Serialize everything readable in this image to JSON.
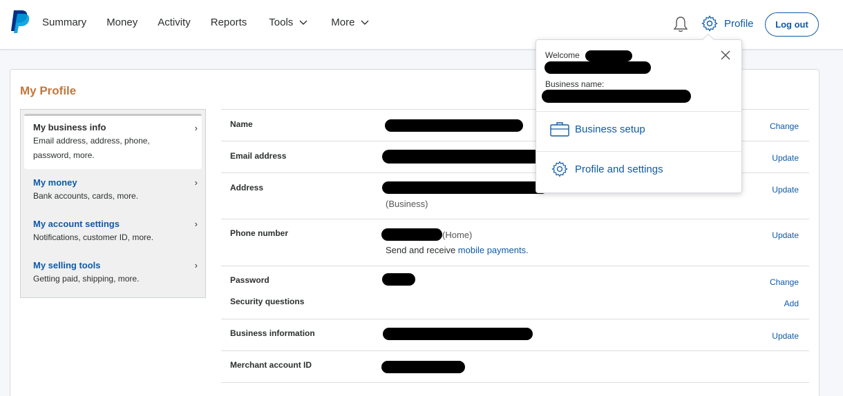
{
  "nav": {
    "items": [
      {
        "label": "Summary"
      },
      {
        "label": "Money"
      },
      {
        "label": "Activity"
      },
      {
        "label": "Reports"
      },
      {
        "label": "Tools",
        "has_menu": true
      },
      {
        "label": "More",
        "has_menu": true
      }
    ],
    "profile_label": "Profile",
    "logout_label": "Log out"
  },
  "page": {
    "title": "My Profile"
  },
  "sidebar": {
    "items": [
      {
        "title": "My business info",
        "desc": "Email address, address, phone, password, more.",
        "active": true
      },
      {
        "title": "My money",
        "desc": "Bank accounts, cards, more."
      },
      {
        "title": "My account settings",
        "desc": "Notifications, customer ID, more."
      },
      {
        "title": "My selling tools",
        "desc": "Getting paid, shipping, more."
      }
    ],
    "chevron": "›"
  },
  "rows": {
    "name": {
      "label": "Name",
      "action": "Change"
    },
    "email": {
      "label": "Email address",
      "action": "Update"
    },
    "address": {
      "label": "Address",
      "action": "Update",
      "note": "(Business)"
    },
    "phone": {
      "label": "Phone number",
      "action": "Update",
      "note": "(Home)",
      "mobile_prefix": "Send and receive ",
      "mobile_link": "mobile payments."
    },
    "password": {
      "label": "Password",
      "action": "Change"
    },
    "security": {
      "label": "Security questions",
      "action": "Add"
    },
    "business": {
      "label": "Business information",
      "action": "Update"
    },
    "merchant": {
      "label": "Merchant account ID"
    }
  },
  "dropdown": {
    "welcome_label": "Welcome",
    "business_name_label": "Business name:",
    "items": [
      {
        "label": "Business setup",
        "icon": "briefcase-icon"
      },
      {
        "label": "Profile and settings",
        "icon": "gear-icon"
      }
    ]
  },
  "colors": {
    "accent": "#0e5aa7",
    "title": "#c0783d",
    "brand_dark": "#003087",
    "brand_light": "#009cde"
  }
}
